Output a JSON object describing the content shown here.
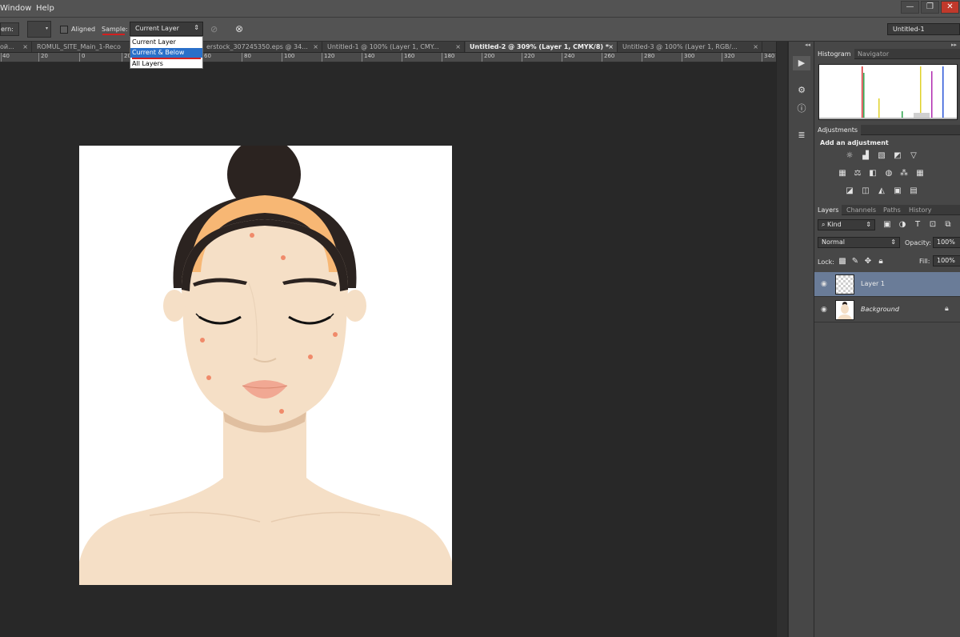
{
  "menubar": {
    "items": [
      "Window",
      "Help"
    ],
    "window_controls": [
      "—",
      "❐",
      "✕"
    ]
  },
  "options": {
    "pattern_label": "ern:",
    "aligned_label": "Aligned",
    "sample_label": "Sample:",
    "sample_value": "Current Layer",
    "sample_options": [
      "Current Layer",
      "Current & Below",
      "All Layers"
    ],
    "workspace_value": "Untitled-1"
  },
  "tabs": [
    {
      "label": "ой...",
      "close": "×"
    },
    {
      "label": "ROMUL_SITE_Main_1-Reco",
      "close": "×"
    },
    {
      "label": "erstock_307245350.eps @ 34...",
      "close": "×"
    },
    {
      "label": "Untitled-1 @ 100% (Layer 1, CMY...",
      "close": "×"
    },
    {
      "label": "Untitled-2 @ 309% (Layer 1, CMYK/8) *",
      "close": "×"
    },
    {
      "label": "Untitled-3 @ 100% (Layer 1, RGB/...",
      "close": "×"
    }
  ],
  "ruler": [
    "40",
    "20",
    "0",
    "20",
    "60",
    "80",
    "100",
    "120",
    "140",
    "160",
    "180",
    "200",
    "220",
    "240",
    "260",
    "280",
    "300",
    "320",
    "340"
  ],
  "panels": {
    "histogram_tab": "Histogram",
    "navigator_tab": "Navigator",
    "adjustments_tab": "Adjustments",
    "add_adjustment": "Add an adjustment",
    "layers_tab": "Layers",
    "channels_tab": "Channels",
    "paths_tab": "Paths",
    "history_tab": "History",
    "kind_filter": "Kind",
    "blend_mode": "Normal",
    "opacity_label": "Opacity:",
    "opacity_value": "100%",
    "lock_label": "Lock:",
    "fill_label": "Fill:",
    "fill_value": "100%"
  },
  "layers": [
    {
      "name": "Layer 1",
      "selected": true
    },
    {
      "name": "Background",
      "locked": true
    }
  ],
  "colors": {
    "skin": "#f5dfc6",
    "hair": "#2b2320",
    "headband": "#f7b774",
    "acne": "#f08a6a",
    "lips": "#f1a893",
    "selection": "#2a70c9",
    "layer_selected": "#6a7c98"
  }
}
